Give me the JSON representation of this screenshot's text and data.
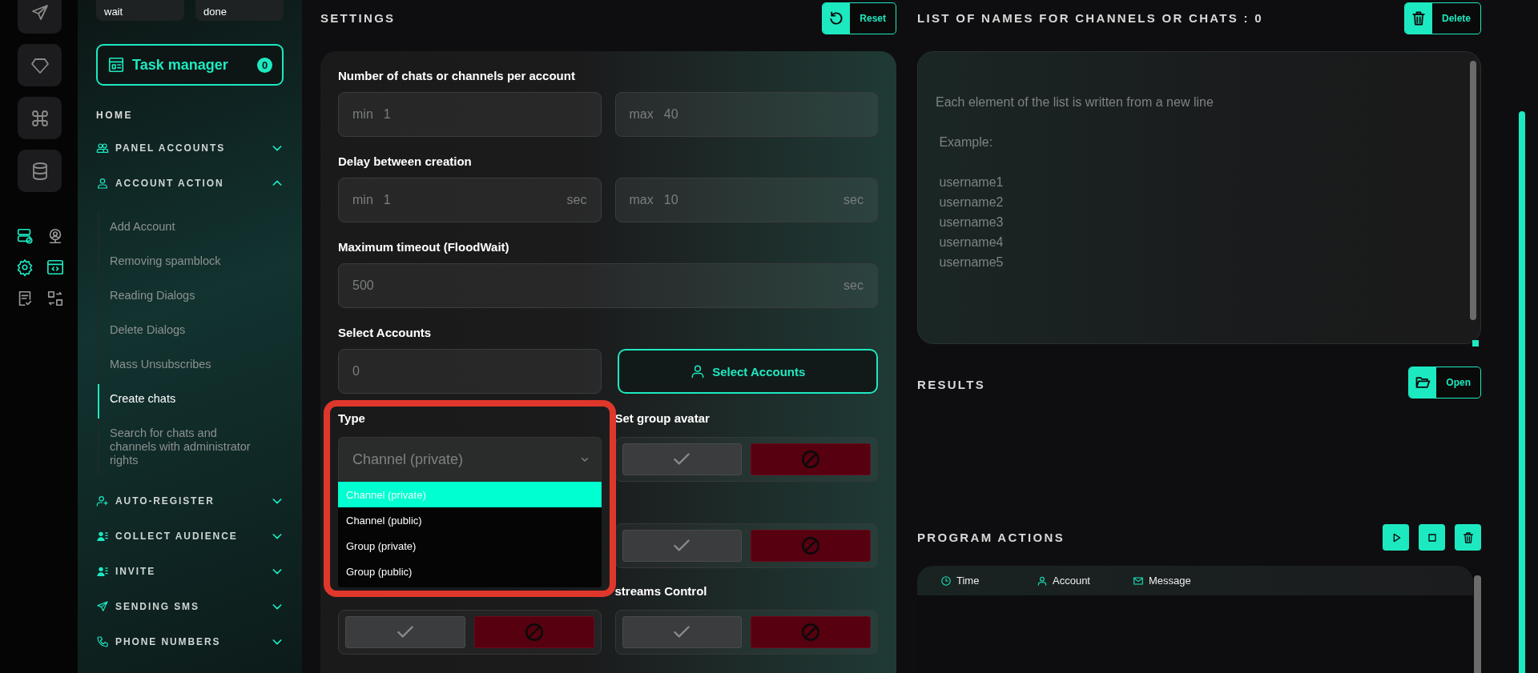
{
  "rail": {
    "tiles": [
      {
        "kind": "send"
      },
      {
        "kind": "diamond"
      },
      {
        "kind": "command"
      },
      {
        "kind": "database"
      }
    ],
    "shortcuts": [
      {
        "kind": "server",
        "active": true
      },
      {
        "kind": "webcam",
        "active": false
      },
      {
        "kind": "gear",
        "active": true
      },
      {
        "kind": "code",
        "active": true
      },
      {
        "kind": "document",
        "active": false
      },
      {
        "kind": "swap",
        "active": false
      }
    ]
  },
  "sidebar": {
    "status_buttons": [
      "wait",
      "done"
    ],
    "task_manager": {
      "label": "Task manager",
      "count": "0"
    },
    "home": "HOME",
    "sections": [
      {
        "label": "PANEL ACCOUNTS",
        "kind": "people",
        "expanded": false
      },
      {
        "label": "ACCOUNT ACTION",
        "kind": "person",
        "expanded": true,
        "children": [
          {
            "label": "Add Account",
            "selected": false
          },
          {
            "label": "Removing spamblock",
            "selected": false
          },
          {
            "label": "Reading Dialogs",
            "selected": false
          },
          {
            "label": "Delete Dialogs",
            "selected": false
          },
          {
            "label": "Mass Unsubscribes",
            "selected": false
          },
          {
            "label": "Create chats",
            "selected": true
          },
          {
            "label": "Search for chats and channels with administrator rights",
            "selected": false
          }
        ]
      },
      {
        "label": "AUTO-REGISTER",
        "kind": "person-plus",
        "expanded": false
      },
      {
        "label": "COLLECT AUDIENCE",
        "kind": "person-list",
        "expanded": false
      },
      {
        "label": "INVITE",
        "kind": "person-list",
        "expanded": false
      },
      {
        "label": "SENDING SMS",
        "kind": "send",
        "expanded": false
      },
      {
        "label": "PHONE NUMBERS",
        "kind": "phone",
        "expanded": false
      }
    ]
  },
  "settings": {
    "title": "SETTINGS",
    "reset_button": "Reset",
    "groups": [
      {
        "label": "Number of chats or channels per account",
        "inputs": [
          {
            "prefix": "min",
            "value": "1"
          },
          {
            "prefix": "max",
            "value": "40"
          }
        ]
      },
      {
        "label": "Delay between creation",
        "inputs": [
          {
            "prefix": "min",
            "value": "1",
            "unit": "sec"
          },
          {
            "prefix": "max",
            "value": "10",
            "unit": "sec"
          }
        ]
      },
      {
        "label": "Maximum timeout (FloodWait)",
        "inputs": [
          {
            "value": "500",
            "unit": "sec"
          }
        ]
      }
    ],
    "select_accounts": {
      "label": "Select Accounts",
      "count": "0",
      "button": "Select Accounts"
    },
    "type": {
      "label": "Type",
      "value": "Channel (private)",
      "expanded": true,
      "options": [
        {
          "label": "Channel (private)",
          "selected": true
        },
        {
          "label": "Channel (public)",
          "selected": false
        },
        {
          "label": "Group (private)",
          "selected": false
        },
        {
          "label": "Group (public)",
          "selected": false
        }
      ]
    },
    "toggles": [
      {
        "label": "Set group avatar",
        "enabled": false
      },
      {
        "enabled": false
      },
      {
        "enabled": false
      },
      {
        "label": "streams Control",
        "enabled": false
      }
    ]
  },
  "names_list": {
    "title": "LIST OF NAMES FOR CHANNELS OR CHATS : 0",
    "delete_button": "Delete",
    "placeholder_lines": [
      "Each element of the list is written from a new line",
      " Example:",
      " username1",
      " username2",
      " username3",
      " username4",
      " username5"
    ]
  },
  "results": {
    "title": "RESULTS",
    "open_button": "Open"
  },
  "program_actions": {
    "title": "PROGRAM ACTIONS",
    "columns": [
      {
        "label": "Time",
        "kind": "clock"
      },
      {
        "label": "Account",
        "kind": "person"
      },
      {
        "label": "Message",
        "kind": "mail"
      }
    ]
  }
}
